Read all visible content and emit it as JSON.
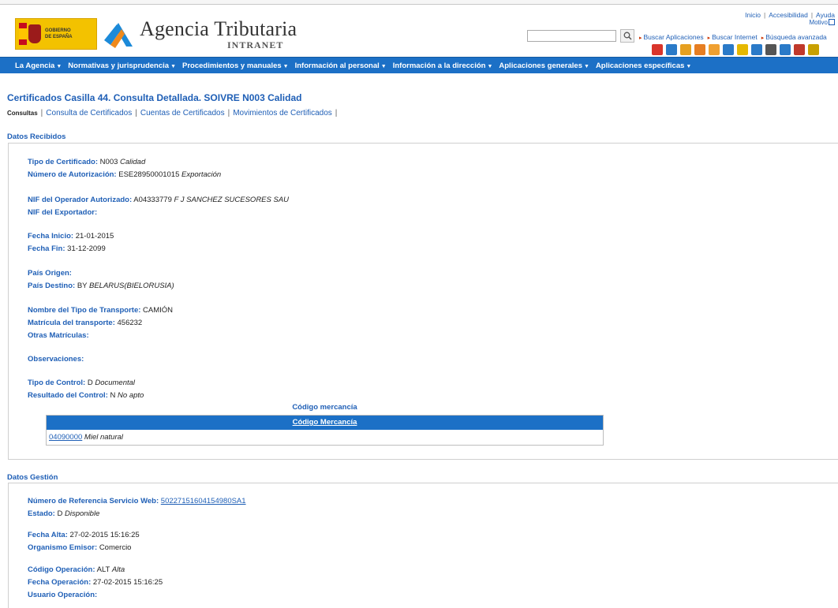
{
  "header": {
    "gobierno_line1": "GOBIERNO",
    "gobierno_line2": "DE ESPAÑA",
    "agency_name": "Agencia Tributaria",
    "agency_sub": "INTRANET",
    "top_links": [
      "Inicio",
      "Accesibilidad",
      "Ayuda"
    ],
    "motivo": "Motivo",
    "search_placeholder": "",
    "quick_links": [
      "Buscar Aplicaciones",
      "Buscar Internet",
      "Búsqueda avanzada"
    ]
  },
  "iconbar": {
    "icons": [
      {
        "name": "chart-icon",
        "color": "#d9352b"
      },
      {
        "name": "download-icon",
        "color": "#2a7ac8"
      },
      {
        "name": "folder-icon",
        "color": "#e6a020"
      },
      {
        "name": "alert-icon",
        "color": "#e67e22"
      },
      {
        "name": "chat-icon",
        "color": "#f0a030"
      },
      {
        "name": "calendar-icon",
        "color": "#2a7ac8"
      },
      {
        "name": "notes-icon",
        "color": "#e6b800"
      },
      {
        "name": "phone-icon",
        "color": "#2a7ac8"
      },
      {
        "name": "mail-icon",
        "color": "#555555"
      },
      {
        "name": "translate-icon",
        "color": "#2a7ac8"
      },
      {
        "name": "close-x-icon",
        "color": "#c0392b"
      },
      {
        "name": "lock-icon",
        "color": "#c8a000"
      }
    ]
  },
  "menu": [
    "La Agencia",
    "Normativas y jurisprudencia",
    "Procedimientos y manuales",
    "Información al personal",
    "Información a la dirección",
    "Aplicaciones generales",
    "Aplicaciones específicas"
  ],
  "page": {
    "title": "Certificados Casilla 44. Consulta Detallada. SOIVRE N003 Calidad",
    "tab_current": "Consultas",
    "tabs": [
      "Consulta de Certificados",
      "Cuentas de Certificados",
      "Movimientos de Certificados"
    ]
  },
  "datos_recibidos": {
    "title": "Datos Recibidos",
    "tipo_certificado": {
      "label": "Tipo de Certificado:",
      "code": "N003",
      "desc": "Calidad"
    },
    "num_autorizacion": {
      "label": "Número de Autorización:",
      "code": "ESE28950001015",
      "desc": "Exportación"
    },
    "nif_operador": {
      "label": "NIF del Operador Autorizado:",
      "code": "A04333779",
      "desc": "F J SANCHEZ SUCESORES SAU"
    },
    "nif_exportador": {
      "label": "NIF del Exportador:"
    },
    "fecha_inicio": {
      "label": "Fecha Inicio:",
      "value": "21-01-2015"
    },
    "fecha_fin": {
      "label": "Fecha Fin:",
      "value": "31-12-2099"
    },
    "pais_origen": {
      "label": "País Origen:"
    },
    "pais_destino": {
      "label": "País Destino:",
      "code": "BY",
      "desc": "BELARUS(BIELORUSIA)"
    },
    "nombre_transporte": {
      "label": "Nombre del Tipo de Transporte:",
      "value": "CAMIÓN"
    },
    "matricula": {
      "label": "Matrícula del transporte:",
      "value": "456232"
    },
    "otras_matriculas": {
      "label": "Otras Matrículas:"
    },
    "observaciones": {
      "label": "Observaciones:"
    },
    "tipo_control": {
      "label": "Tipo de Control:",
      "code": "D",
      "desc": "Documental"
    },
    "resultado_control": {
      "label": "Resultado del Control:",
      "code": "N",
      "desc": "No apto"
    },
    "mercancia": {
      "caption": "Código mercancía",
      "header": "Código Mercancía",
      "rows": [
        {
          "code": "04090000",
          "desc": "Miel natural"
        }
      ]
    }
  },
  "datos_gestion": {
    "title": "Datos Gestión",
    "num_referencia": {
      "label": "Número de Referencia Servicio Web:",
      "value": "50227151604154980SA1"
    },
    "estado": {
      "label": "Estado:",
      "code": "D",
      "desc": "Disponible"
    },
    "fecha_alta": {
      "label": "Fecha Alta:",
      "value": "27-02-2015 15:16:25"
    },
    "organismo": {
      "label": "Organismo Emisor:",
      "value": "Comercio"
    },
    "codigo_operacion": {
      "label": "Código Operación:",
      "code": "ALT",
      "desc": "Alta"
    },
    "fecha_operacion": {
      "label": "Fecha Operación:",
      "value": "27-02-2015 15:16:25"
    },
    "usuario_operacion": {
      "label": "Usuario Operación:"
    }
  }
}
